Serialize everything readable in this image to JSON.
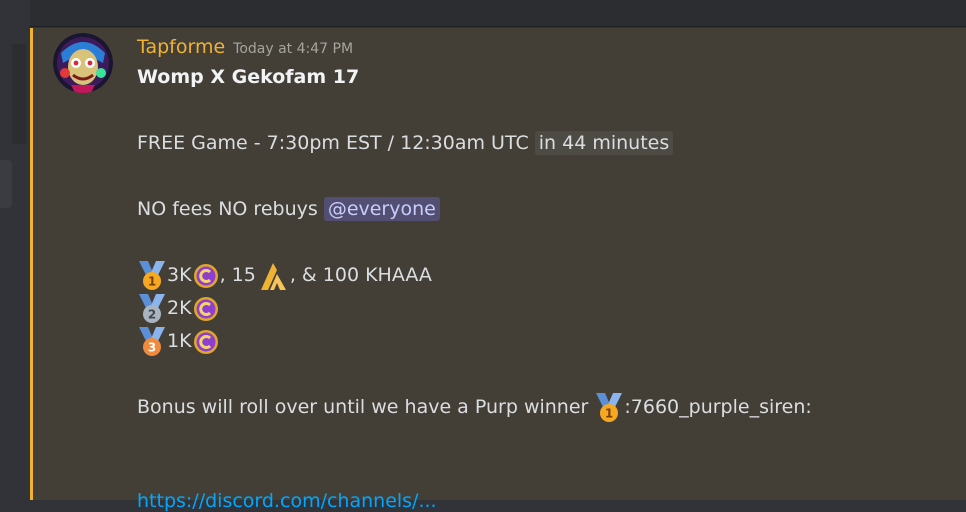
{
  "message": {
    "author": "Tapforme",
    "timestamp": "Today at 4:47 PM",
    "title": "Womp X Gekofam 17",
    "game_line_text": "FREE Game - 7:30pm EST / 12:30am UTC",
    "relative_time": "in 44 minutes",
    "fees_line_text": "NO fees NO rebuys",
    "mention": "@everyone",
    "prizes": [
      {
        "place": "1",
        "amount": "3K",
        "extra": ", 15",
        "extra2": ", & 100 KHAAA"
      },
      {
        "place": "2",
        "amount": "2K"
      },
      {
        "place": "3",
        "amount": "1K"
      }
    ],
    "bonus_text": "Bonus will roll over until we have a Purp winner",
    "bonus_emoji_text": ":7660_purple_siren:",
    "link_text": "https://discord.com/channels/..."
  },
  "colors": {
    "accent": "#f0b232",
    "mention_bg": "#524f73",
    "highlight_bg": "#433f37"
  },
  "icons": {
    "avatar": "avatar-image",
    "medal_gold": "first-place-medal-icon",
    "medal_silver": "second-place-medal-icon",
    "medal_bronze": "third-place-medal-icon",
    "coin": "purple-coin-icon",
    "token": "gold-spike-token-icon"
  }
}
